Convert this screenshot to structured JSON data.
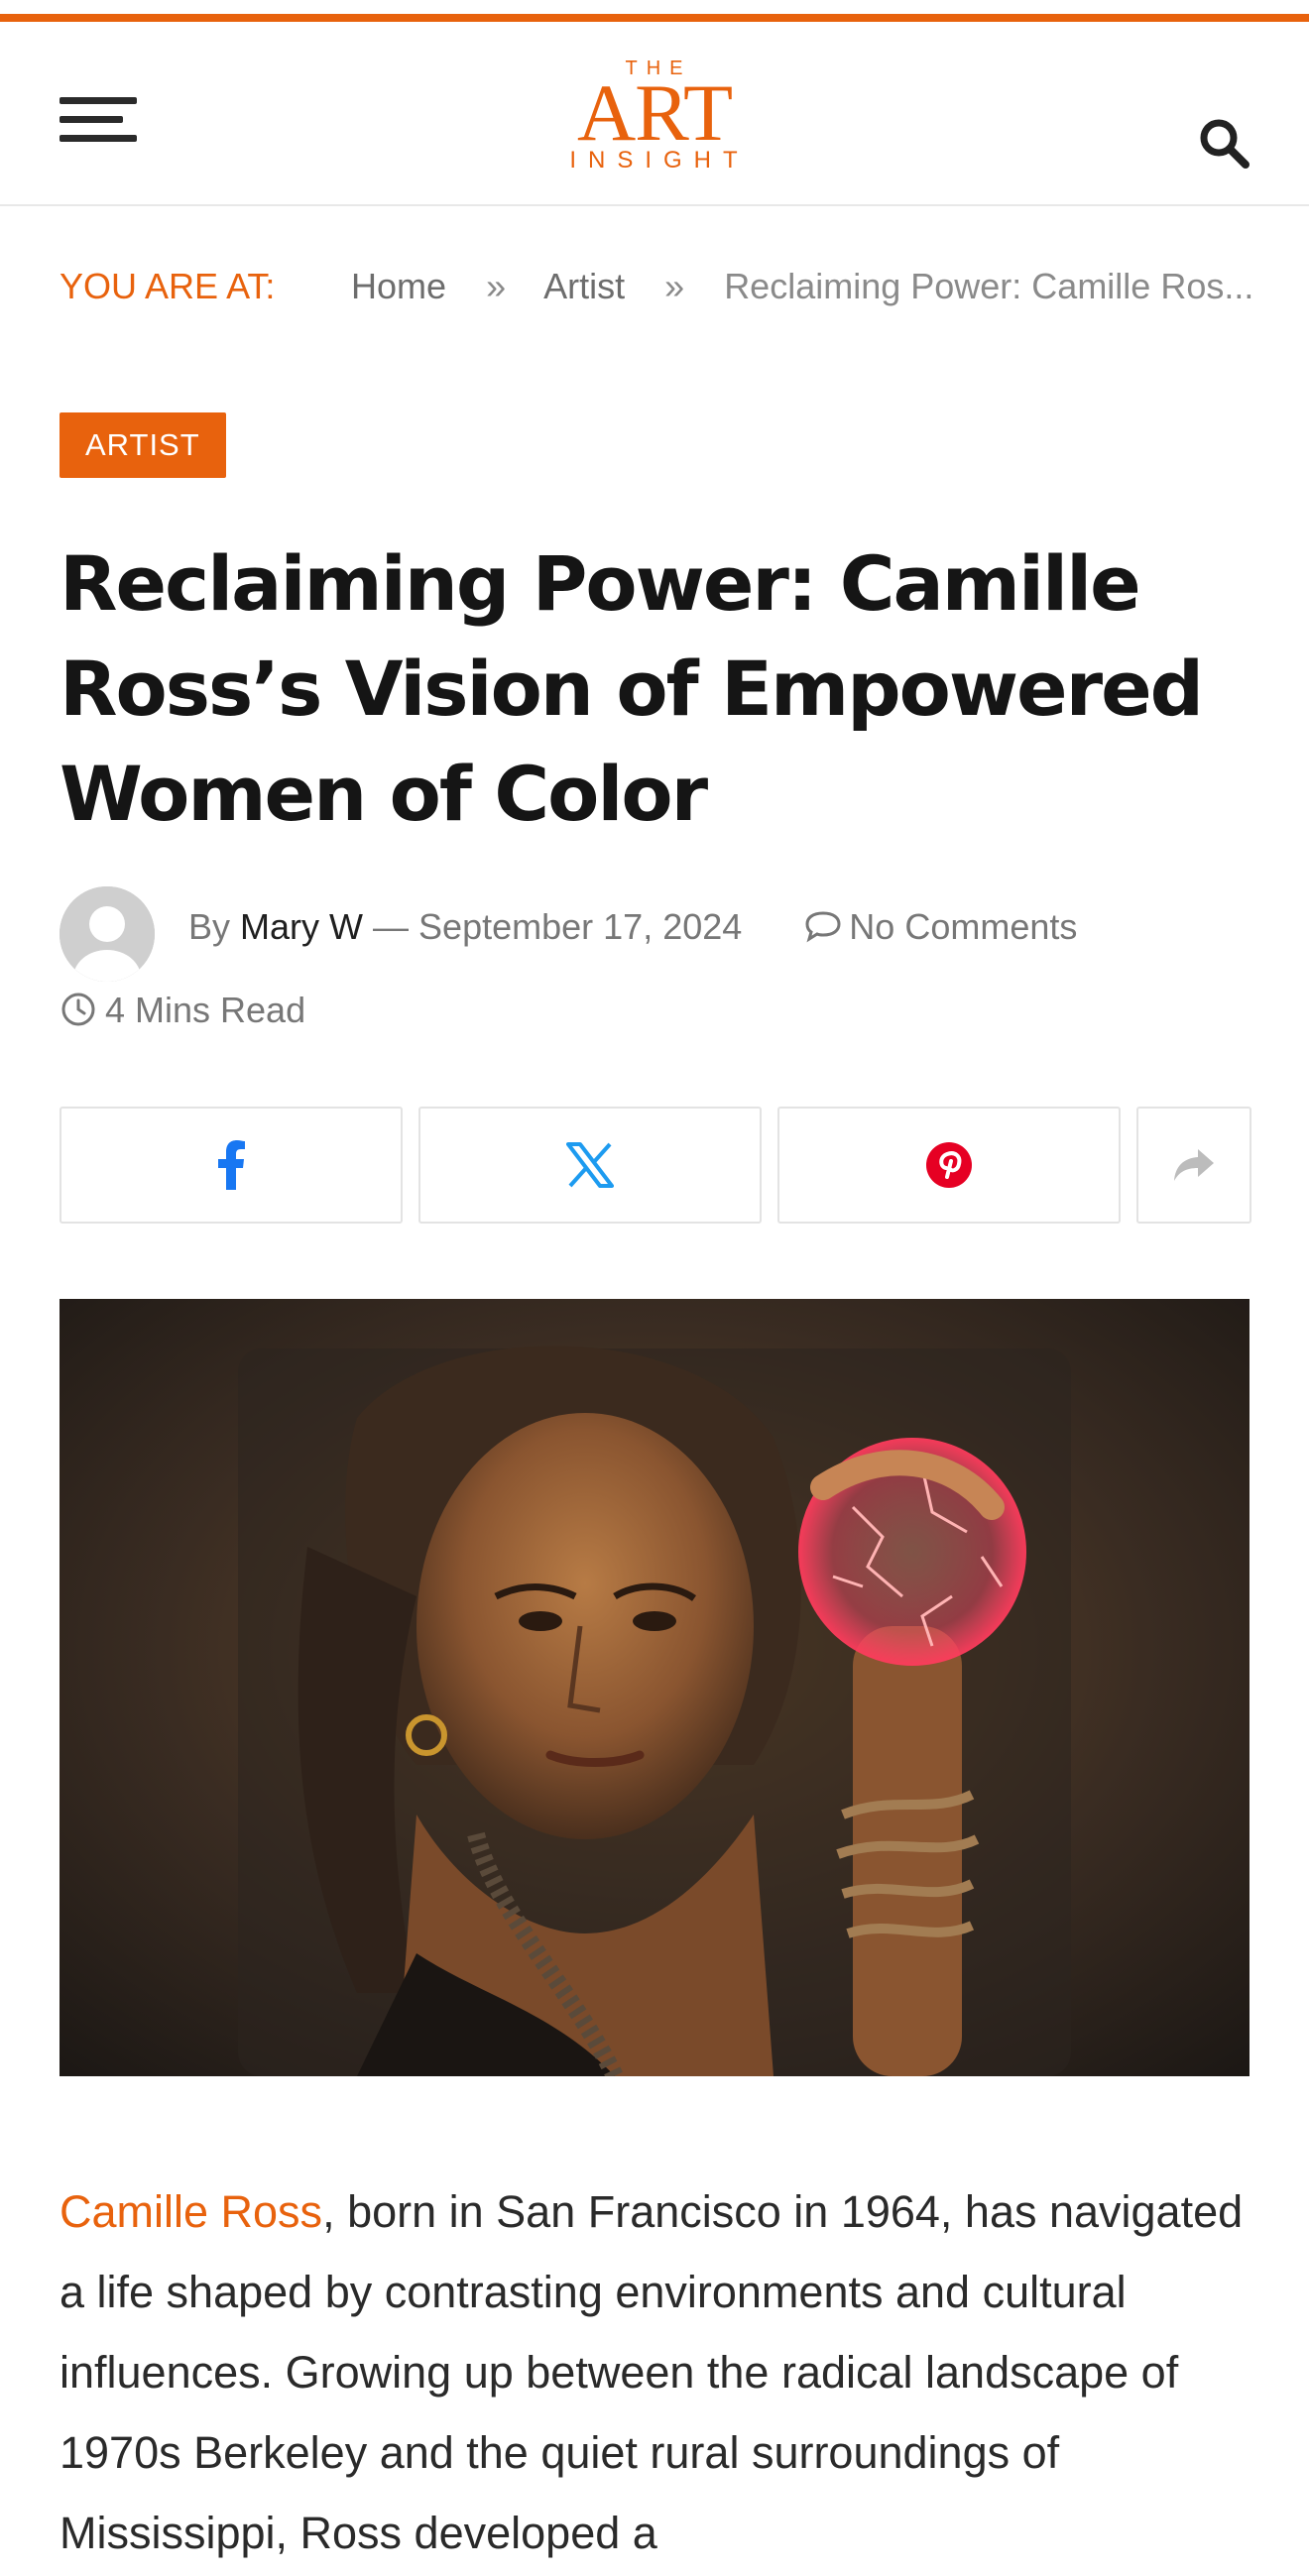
{
  "colors": {
    "accent": "#e8620d",
    "facebook": "#1877f2",
    "x": "#1d9bf0",
    "pinterest": "#e60023"
  },
  "header": {
    "logo": {
      "the": "THE",
      "art": "ART",
      "insight": "INSIGHT"
    },
    "menu_icon": "hamburger-icon",
    "search_icon": "search-icon"
  },
  "breadcrumb": {
    "label": "YOU ARE AT:",
    "items": [
      "Home",
      "Artist",
      "Reclaiming Power: Camille Ros..."
    ],
    "separator": "»"
  },
  "article": {
    "category": "ARTIST",
    "title": "Reclaiming Power: Camille Ross’s Vision of Empowered Women of Color",
    "by": "By",
    "author": "Mary W",
    "dash": "—",
    "date": "September 17, 2024",
    "comments": "No Comments",
    "read_time": "4 Mins Read",
    "body_link": "Camille Ross",
    "body_text": ", born in San Francisco in 1964, has navigated a life shaped by contrasting environments and cultural influences. Growing up between the radical landscape of 1970s Berkeley and the quiet rural surroundings of Mississippi, Ross developed a"
  },
  "share": {
    "buttons": [
      "facebook-icon",
      "x-icon",
      "pinterest-icon",
      "share-icon"
    ]
  }
}
